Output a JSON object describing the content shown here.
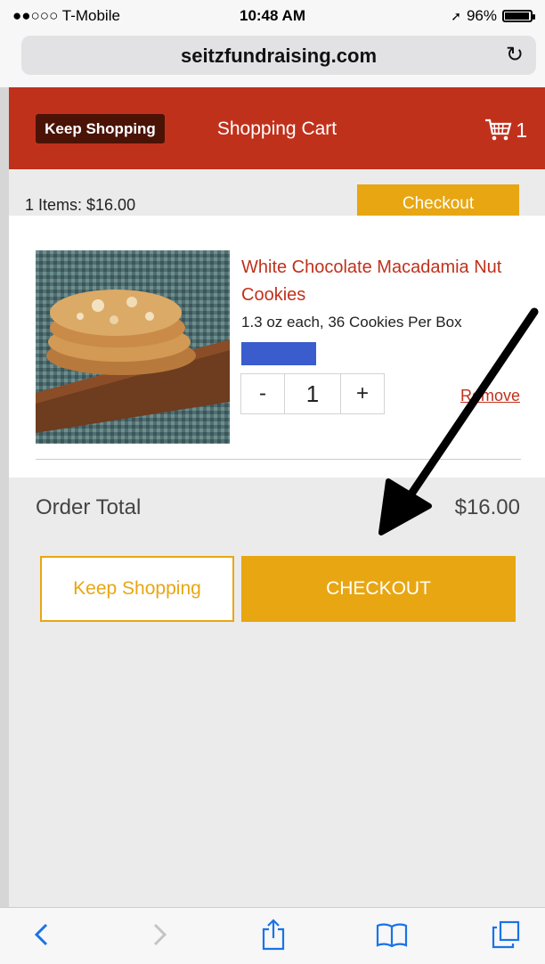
{
  "status_bar": {
    "carrier": "●●○○○ T-Mobile",
    "time": "10:48 AM",
    "battery": "96%",
    "battery_level": 0.96
  },
  "browser": {
    "domain": "seitzfundraising.com",
    "reload_icon": "reload-icon"
  },
  "header": {
    "keep_shopping": "Keep Shopping",
    "title": "Shopping Cart",
    "cart_count": "1",
    "cart_icon": "cart-icon"
  },
  "summary": {
    "items_text": "1 Items: $16.00",
    "checkout_label": "Checkout"
  },
  "product": {
    "name": "White Chocolate Macadamia Nut Cookies",
    "description": "1.3 oz each, 36 Cookies Per Box",
    "quantity": "1",
    "minus": "-",
    "plus": "+",
    "remove": "Remove"
  },
  "order": {
    "label": "Order Total",
    "total": "$16.00",
    "keep_shopping": "Keep Shopping",
    "checkout": "CHECKOUT"
  },
  "colors": {
    "brand_red": "#c0311c",
    "accent_gold": "#e8a612",
    "dark_brown": "#4a1306"
  }
}
